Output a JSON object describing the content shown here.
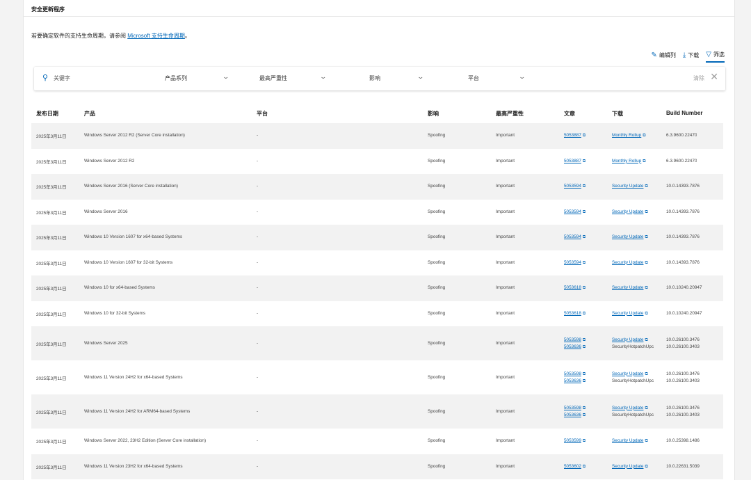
{
  "page": {
    "section_title": "安全更新程序",
    "intro_text": "若要确定软件的支持生命周期，请参阅 ",
    "intro_link": "Microsoft 支持生命周期",
    "intro_end": "。"
  },
  "actions": {
    "edit_columns": "编辑列",
    "download": "下载",
    "filter": "筛选"
  },
  "filters": {
    "keyword_placeholder": "关键字",
    "product_family": "产品系列",
    "max_severity": "最高严重性",
    "impact": "影响",
    "platform": "平台",
    "clear": "清除"
  },
  "table": {
    "headers": {
      "release_date": "发布日期",
      "product": "产品",
      "platform": "平台",
      "impact": "影响",
      "max_severity": "最高严重性",
      "article": "文章",
      "download": "下载",
      "build_number": "Build Number"
    },
    "rows": [
      {
        "date": "2025年3月11日",
        "product": "Windows Server 2012 R2 (Server Core installation)",
        "platform": "-",
        "impact": "Spoofing",
        "severity": "Important",
        "articles": [
          "5053887"
        ],
        "downloads": [
          "Monthly Rollup"
        ],
        "downloads_plain": [],
        "builds": [
          "6.3.9600.22470"
        ]
      },
      {
        "date": "2025年3月11日",
        "product": "Windows Server 2012 R2",
        "platform": "-",
        "impact": "Spoofing",
        "severity": "Important",
        "articles": [
          "5053887"
        ],
        "downloads": [
          "Monthly Rollup"
        ],
        "downloads_plain": [],
        "builds": [
          "6.3.9600.22470"
        ]
      },
      {
        "date": "2025年3月11日",
        "product": "Windows Server 2016 (Server Core installation)",
        "platform": "-",
        "impact": "Spoofing",
        "severity": "Important",
        "articles": [
          "5053594"
        ],
        "downloads": [
          "Security Update"
        ],
        "downloads_plain": [],
        "builds": [
          "10.0.14393.7876"
        ]
      },
      {
        "date": "2025年3月11日",
        "product": "Windows Server 2016",
        "platform": "-",
        "impact": "Spoofing",
        "severity": "Important",
        "articles": [
          "5053594"
        ],
        "downloads": [
          "Security Update"
        ],
        "downloads_plain": [],
        "builds": [
          "10.0.14393.7876"
        ]
      },
      {
        "date": "2025年3月11日",
        "product": "Windows 10 Version 1607 for x64-based Systems",
        "platform": "-",
        "impact": "Spoofing",
        "severity": "Important",
        "articles": [
          "5053594"
        ],
        "downloads": [
          "Security Update"
        ],
        "downloads_plain": [],
        "builds": [
          "10.0.14393.7876"
        ]
      },
      {
        "date": "2025年3月11日",
        "product": "Windows 10 Version 1607 for 32-bit Systems",
        "platform": "-",
        "impact": "Spoofing",
        "severity": "Important",
        "articles": [
          "5053594"
        ],
        "downloads": [
          "Security Update"
        ],
        "downloads_plain": [],
        "builds": [
          "10.0.14393.7876"
        ]
      },
      {
        "date": "2025年3月11日",
        "product": "Windows 10 for x64-based Systems",
        "platform": "-",
        "impact": "Spoofing",
        "severity": "Important",
        "articles": [
          "5053618"
        ],
        "downloads": [
          "Security Update"
        ],
        "downloads_plain": [],
        "builds": [
          "10.0.10240.20947"
        ]
      },
      {
        "date": "2025年3月11日",
        "product": "Windows 10 for 32-bit Systems",
        "platform": "-",
        "impact": "Spoofing",
        "severity": "Important",
        "articles": [
          "5053618"
        ],
        "downloads": [
          "Security Update"
        ],
        "downloads_plain": [],
        "builds": [
          "10.0.10240.20947"
        ]
      },
      {
        "date": "2025年3月11日",
        "product": "Windows Server 2025",
        "platform": "-",
        "impact": "Spoofing",
        "severity": "Important",
        "articles": [
          "5053598",
          "5053636"
        ],
        "downloads": [
          "Security Update"
        ],
        "downloads_plain": [
          "SecurityHotpatchUpc"
        ],
        "builds": [
          "10.0.26100.3476",
          "10.0.26100.3403"
        ]
      },
      {
        "date": "2025年3月11日",
        "product": "Windows 11 Version 24H2 for x64-based Systems",
        "platform": "-",
        "impact": "Spoofing",
        "severity": "Important",
        "articles": [
          "5053598",
          "5053636"
        ],
        "downloads": [
          "Security Update"
        ],
        "downloads_plain": [
          "SecurityHotpatchUpc"
        ],
        "builds": [
          "10.0.26100.3476",
          "10.0.26100.3403"
        ]
      },
      {
        "date": "2025年3月11日",
        "product": "Windows 11 Version 24H2 for ARM64-based Systems",
        "platform": "-",
        "impact": "Spoofing",
        "severity": "Important",
        "articles": [
          "5053598",
          "5053636"
        ],
        "downloads": [
          "Security Update"
        ],
        "downloads_plain": [
          "SecurityHotpatchUpc"
        ],
        "builds": [
          "10.0.26100.3476",
          "10.0.26100.3403"
        ]
      },
      {
        "date": "2025年3月11日",
        "product": "Windows Server 2022, 23H2 Edition (Server Core installation)",
        "platform": "-",
        "impact": "Spoofing",
        "severity": "Important",
        "articles": [
          "5053599"
        ],
        "downloads": [
          "Security Update"
        ],
        "downloads_plain": [],
        "builds": [
          "10.0.25398.1486"
        ]
      },
      {
        "date": "2025年3月11日",
        "product": "Windows 11 Version 23H2 for x64-based Systems",
        "platform": "-",
        "impact": "Spoofing",
        "severity": "Important",
        "articles": [
          "5053602"
        ],
        "downloads": [
          "Security Update"
        ],
        "downloads_plain": [],
        "builds": [
          "10.0.22631.5039"
        ]
      }
    ]
  },
  "colors": {
    "accent": "#0067b8",
    "row_alt": "#f2f2f2"
  }
}
